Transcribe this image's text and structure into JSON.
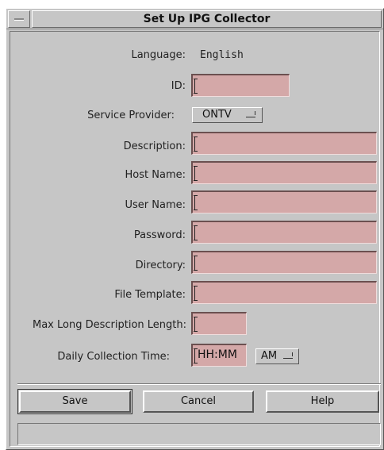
{
  "window": {
    "title": "Set Up IPG Collector"
  },
  "form": {
    "language_label": "Language:",
    "language_value": "English",
    "id_label": "ID:",
    "id_value": "",
    "service_provider_label": "Service Provider:",
    "service_provider_value": "ONTV",
    "description_label": "Description:",
    "description_value": "",
    "host_name_label": "Host Name:",
    "host_name_value": "",
    "user_name_label": "User Name:",
    "user_name_value": "",
    "password_label": "Password:",
    "password_value": "",
    "directory_label": "Directory:",
    "directory_value": "",
    "file_template_label": "File Template:",
    "file_template_value": "",
    "max_long_desc_label": "Max Long Description Length:",
    "max_long_desc_value": "",
    "daily_time_label": "Daily Collection Time:",
    "daily_time_value": "HH:MM",
    "ampm_value": "AM"
  },
  "buttons": {
    "save": "Save",
    "cancel": "Cancel",
    "help": "Help"
  },
  "status": {
    "text": ""
  },
  "colors": {
    "background": "#c6c6c6",
    "field": "#d4a8a8"
  },
  "icons": {
    "window_menu": "window-menu-icon",
    "option_indicator": "option-menu-indicator-icon"
  }
}
